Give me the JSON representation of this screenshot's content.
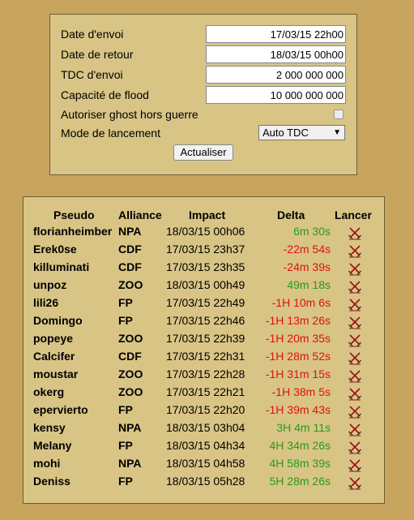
{
  "settings": {
    "send_date_label": "Date d'envoi",
    "send_date_value": "17/03/15 22h00",
    "return_date_label": "Date de retour",
    "return_date_value": "18/03/15 00h00",
    "tdc_label": "TDC d'envoi",
    "tdc_value": "2 000 000 000",
    "flood_label": "Capacité de flood",
    "flood_value": "10 000 000 000",
    "ghost_label": "Autoriser ghost hors guerre",
    "launch_mode_label": "Mode de lancement",
    "launch_mode_value": "Auto TDC",
    "refresh_button": "Actualiser"
  },
  "table": {
    "headers": {
      "pseudo": "Pseudo",
      "alliance": "Alliance",
      "impact": "Impact",
      "delta": "Delta",
      "launch": "Lancer"
    },
    "rows": [
      {
        "pseudo": "florianheimber",
        "alliance": "NPA",
        "impact": "18/03/15 00h06",
        "delta": "6m 30s",
        "status": "positive"
      },
      {
        "pseudo": "Erek0se",
        "alliance": "CDF",
        "impact": "17/03/15 23h37",
        "delta": "-22m 54s",
        "status": "negative"
      },
      {
        "pseudo": "killuminati",
        "alliance": "CDF",
        "impact": "17/03/15 23h35",
        "delta": "-24m 39s",
        "status": "negative"
      },
      {
        "pseudo": "unpoz",
        "alliance": "ZOO",
        "impact": "18/03/15 00h49",
        "delta": "49m 18s",
        "status": "positive"
      },
      {
        "pseudo": "lili26",
        "alliance": "FP",
        "impact": "17/03/15 22h49",
        "delta": "-1H 10m 6s",
        "status": "negative"
      },
      {
        "pseudo": "Domingo",
        "alliance": "FP",
        "impact": "17/03/15 22h46",
        "delta": "-1H 13m 26s",
        "status": "negative"
      },
      {
        "pseudo": "popeye",
        "alliance": "ZOO",
        "impact": "17/03/15 22h39",
        "delta": "-1H 20m 35s",
        "status": "negative"
      },
      {
        "pseudo": "Calcifer",
        "alliance": "CDF",
        "impact": "17/03/15 22h31",
        "delta": "-1H 28m 52s",
        "status": "negative"
      },
      {
        "pseudo": "moustar",
        "alliance": "ZOO",
        "impact": "17/03/15 22h28",
        "delta": "-1H 31m 15s",
        "status": "negative"
      },
      {
        "pseudo": "okerg",
        "alliance": "ZOO",
        "impact": "17/03/15 22h21",
        "delta": "-1H 38m 5s",
        "status": "negative"
      },
      {
        "pseudo": "epervierto",
        "alliance": "FP",
        "impact": "17/03/15 22h20",
        "delta": "-1H 39m 43s",
        "status": "negative"
      },
      {
        "pseudo": "kensy",
        "alliance": "NPA",
        "impact": "18/03/15 03h04",
        "delta": "3H 4m 11s",
        "status": "positive"
      },
      {
        "pseudo": "Melany",
        "alliance": "FP",
        "impact": "18/03/15 04h34",
        "delta": "4H 34m 26s",
        "status": "positive"
      },
      {
        "pseudo": "mohi",
        "alliance": "NPA",
        "impact": "18/03/15 04h58",
        "delta": "4H 58m 39s",
        "status": "positive"
      },
      {
        "pseudo": "Deniss",
        "alliance": "FP",
        "impact": "18/03/15 05h28",
        "delta": "5H 28m 26s",
        "status": "positive"
      }
    ]
  },
  "colors": {
    "background": "#c8a55f",
    "panel": "#d8c485",
    "positive": "#2a9a1a",
    "negative": "#e01010",
    "launch_icon": "#a01010"
  },
  "icons": {
    "launch": "crossed-swords-icon",
    "select_arrow": "chevron-down-icon"
  }
}
